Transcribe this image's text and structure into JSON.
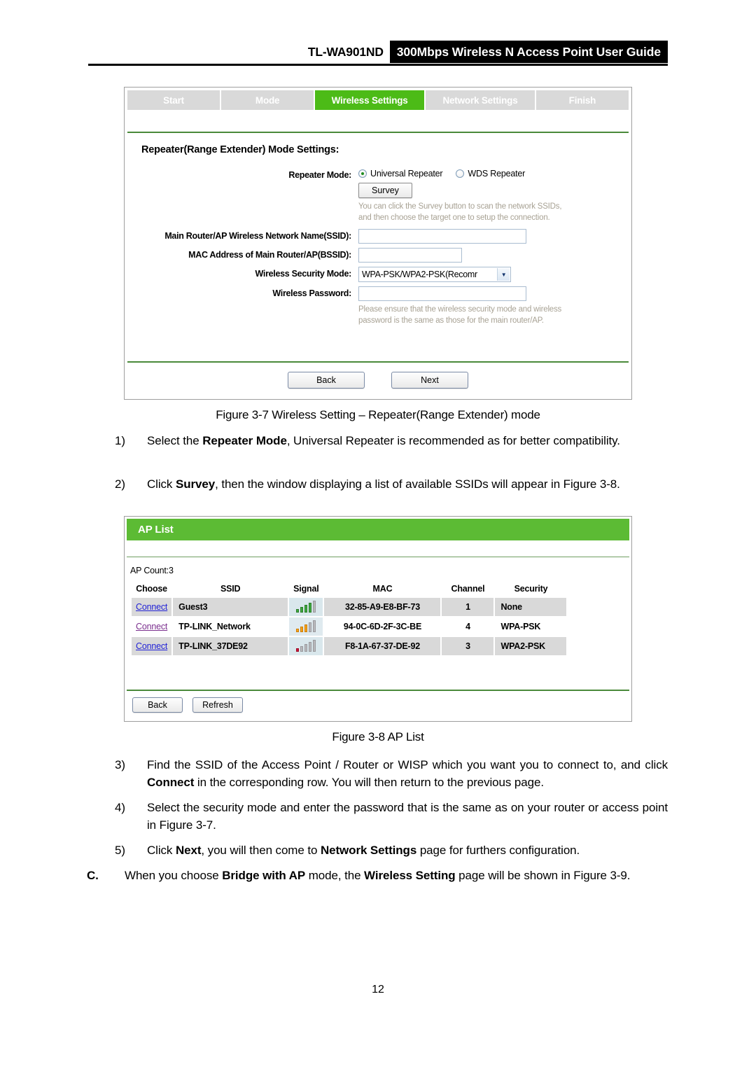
{
  "header": {
    "model": "TL-WA901ND",
    "title": "300Mbps Wireless N Access Point User Guide"
  },
  "figure_3_7": {
    "wizard_steps": [
      {
        "label": "Start",
        "active": false
      },
      {
        "label": "Mode",
        "active": false
      },
      {
        "label": "Wireless Settings",
        "active": true
      },
      {
        "label": "Network Settings",
        "active": false
      },
      {
        "label": "Finish",
        "active": false
      }
    ],
    "panel_title": "Repeater(Range Extender) Mode Settings:",
    "repeater_mode_label": "Repeater Mode:",
    "radio_universal": "Universal Repeater",
    "radio_wds": "WDS Repeater",
    "survey_button": "Survey",
    "survey_hint": "You can click the Survey button to scan the network SSIDs, and then choose the target one to setup the connection.",
    "ssid_label": "Main Router/AP Wireless Network Name(SSID):",
    "ssid_value": "",
    "bssid_label": "MAC Address of Main Router/AP(BSSID):",
    "bssid_value": "",
    "security_mode_label": "Wireless Security Mode:",
    "security_mode_value": "WPA-PSK/WPA2-PSK(Recomr",
    "password_label": "Wireless Password:",
    "password_value": "",
    "password_hint": "Please ensure that the wireless security mode and wireless password is the same as those for the main router/AP.",
    "back_button": "Back",
    "next_button": "Next",
    "caption": "Figure 3-7 Wireless Setting – Repeater(Range Extender) mode",
    "accent_green": "#4cbb17",
    "step_gray": "#d9d9d9"
  },
  "figure_3_8": {
    "panel_title": "AP List",
    "ap_count_label": "AP Count:",
    "ap_count_value": "3",
    "columns": [
      "Choose",
      "SSID",
      "Signal",
      "MAC",
      "Channel",
      "Security"
    ],
    "rows": [
      {
        "choose": "Connect",
        "choose_visited": false,
        "ssid": "Guest3",
        "signal_filled": 4,
        "signal_total": 5,
        "signal_color": "green",
        "mac": "32-85-A9-E8-BF-73",
        "channel": "1",
        "security": "None"
      },
      {
        "choose": "Connect",
        "choose_visited": true,
        "ssid": "TP-LINK_Network",
        "signal_filled": 3,
        "signal_total": 5,
        "signal_color": "orange",
        "mac": "94-0C-6D-2F-3C-BE",
        "channel": "4",
        "security": "WPA-PSK"
      },
      {
        "choose": "Connect",
        "choose_visited": false,
        "ssid": "TP-LINK_37DE92",
        "signal_filled": 1,
        "signal_total": 5,
        "signal_color": "red",
        "mac": "F8-1A-67-37-DE-92",
        "channel": "3",
        "security": "WPA2-PSK"
      }
    ],
    "back_button": "Back",
    "refresh_button": "Refresh",
    "caption": "Figure 3-8 AP List",
    "accent_green": "#5cbb34"
  },
  "body_items": {
    "item1_marker": "1)",
    "item1_text_a": "Select the ",
    "item1_bold_a": "Repeater Mode",
    "item1_text_b": ", Universal Repeater is recommended as for better compatibility.",
    "item2_marker": "2)",
    "item2_text_a": "Click ",
    "item2_bold_a": "Survey",
    "item2_text_b": ", then the window displaying a list of available SSIDs will appear in Figure 3-8.",
    "item3_marker": "3)",
    "item3_text_a": "Find the SSID of the Access Point / Router or WISP which you want you to connect to, and click ",
    "item3_bold_a": "Connect",
    "item3_text_b": " in the corresponding row. You will then return to the previous page.",
    "item4_marker": "4)",
    "item4_text_a": "Select the security mode and enter the password that is the same as on your router or access point in Figure 3-7.",
    "item5_marker": "5)",
    "item5_text_a": "Click ",
    "item5_bold_a": "Next",
    "item5_text_b": ", you will then come to ",
    "item5_bold_b": "Network Settings",
    "item5_text_c": " page for furthers configuration.",
    "itemC_marker": "C.",
    "itemC_text_a": "When you choose ",
    "itemC_bold_a": "Bridge with AP",
    "itemC_text_b": " mode, the ",
    "itemC_bold_b": "Wireless Setting",
    "itemC_text_c": " page will be shown in Figure 3-9."
  },
  "footer": {
    "page_number": "12"
  }
}
